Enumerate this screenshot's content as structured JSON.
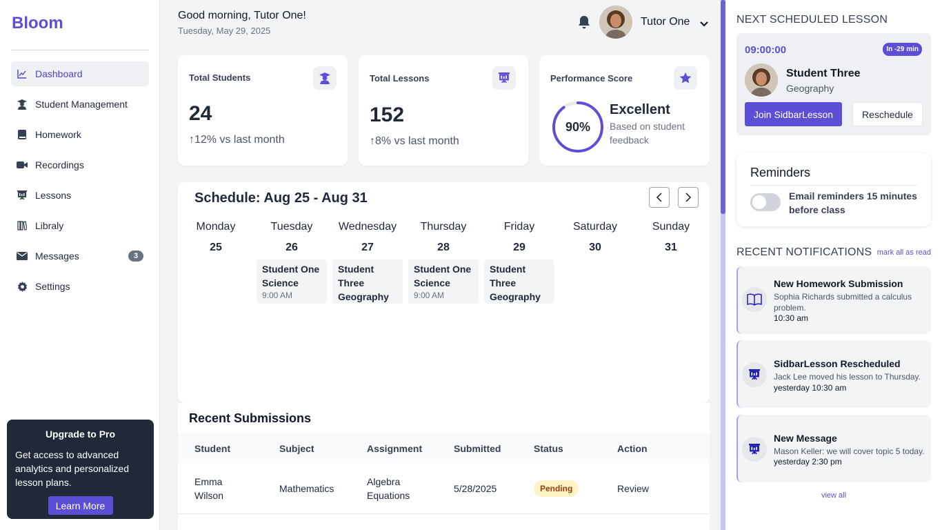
{
  "app": {
    "name": "Bloom",
    "accent": "#5b4fd6"
  },
  "sidebar": {
    "items": [
      {
        "label": "Dashboard",
        "icon": "chart-line-icon"
      },
      {
        "label": "Student Management",
        "icon": "graduate-icon"
      },
      {
        "label": "Homework",
        "icon": "book-icon"
      },
      {
        "label": "Recordings",
        "icon": "video-icon"
      },
      {
        "label": "Lessons",
        "icon": "presentation-icon"
      },
      {
        "label": "Libraly",
        "icon": "library-icon"
      },
      {
        "label": "Messages",
        "icon": "envelope-icon",
        "badge": "3"
      },
      {
        "label": "Settings",
        "icon": "gear-icon"
      }
    ],
    "upgrade": {
      "title": "Upgrade to Pro",
      "text": "Get access to advanced analytics and personalized lesson plans.",
      "button": "Learn More"
    }
  },
  "header": {
    "greeting": "Good morning, Tutor One!",
    "date": "Tuesday, May 29, 2025",
    "user_name": "Tutor One"
  },
  "stats": {
    "students": {
      "title": "Total Students",
      "value": "24",
      "change": "↑12% vs last month"
    },
    "lessons": {
      "title": "Total Lessons",
      "value": "152",
      "change": "↑8% vs last month"
    },
    "performance": {
      "title": "Performance Score",
      "value": "90%",
      "percent": 90,
      "label": "Excellent",
      "desc": "Based on student feedback"
    }
  },
  "schedule": {
    "title": "Schedule: Aug 25 - Aug 31",
    "days": [
      {
        "name": "Monday",
        "num": "25"
      },
      {
        "name": "Tuesday",
        "num": "26"
      },
      {
        "name": "Wednesday",
        "num": "27"
      },
      {
        "name": "Thursday",
        "num": "28"
      },
      {
        "name": "Friday",
        "num": "29"
      },
      {
        "name": "Saturday",
        "num": "30"
      },
      {
        "name": "Sunday",
        "num": "31"
      }
    ],
    "events": [
      {
        "day": "Tuesday",
        "title": "Student One Science",
        "time": "9:00 AM"
      },
      {
        "day": "Wednesday",
        "title": "Student Three Geography",
        "time": ""
      },
      {
        "day": "Thursday",
        "title": "Student One Science",
        "time": "9:00 AM"
      },
      {
        "day": "Friday",
        "title": "Student Three Geography",
        "time": ""
      }
    ]
  },
  "submissions": {
    "title": "Recent Submissions",
    "columns": [
      "Student",
      "Subject",
      "Assignment",
      "Submitted",
      "Status",
      "Action"
    ],
    "rows": [
      {
        "student": "Emma Wilson",
        "subject": "Mathematics",
        "assignment": "Algebra Equations",
        "submitted": "5/28/2025",
        "status": "Pending",
        "action": "Review"
      }
    ]
  },
  "next_lesson": {
    "heading": "NEXT SCHEDULED LESSON",
    "time": "09:00:00",
    "countdown": "In -29 min",
    "student": "Student Three",
    "subject": "Geography",
    "join_label": "Join SidbarLesson",
    "reschedule_label": "Reschedule"
  },
  "reminders": {
    "title": "Reminders",
    "text": "Email reminders 15 minutes before class",
    "enabled": false
  },
  "notifications": {
    "heading": "RECENT NOTIFICATIONS",
    "mark_all": "mark all as read",
    "view_all": "view all",
    "items": [
      {
        "icon": "open-book-icon",
        "title": "New Homework Submission",
        "message": "Sophia Richards submitted a calculus problem.",
        "time": "10:30 am"
      },
      {
        "icon": "presentation-icon",
        "title": "SidbarLesson Rescheduled",
        "message": "Jack Lee moved his lesson to Thursday.",
        "time": "yesterday 10:30 am"
      },
      {
        "icon": "presentation-icon",
        "title": "New Message",
        "message": "Mason Keller: we will cover topic 5 today.",
        "time": "yesterday 2:30 pm"
      }
    ]
  }
}
